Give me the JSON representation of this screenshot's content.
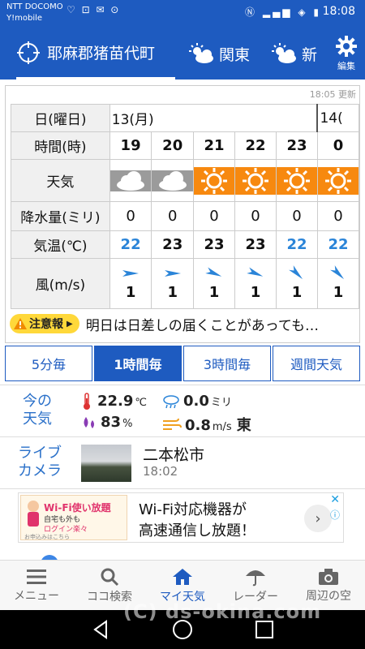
{
  "statusbar": {
    "carrier_line1": "NTT DOCOMO",
    "carrier_line2": "Y!mobile",
    "time": "18:08"
  },
  "header": {
    "tabs": [
      {
        "label": "耶麻郡猪苗代町",
        "icon": "location-target-icon",
        "active": true
      },
      {
        "label": "関東",
        "icon": "sun-cloud-icon",
        "active": false
      },
      {
        "label": "新",
        "icon": "sun-cloud-icon",
        "active": false
      }
    ],
    "settings_label": "編集"
  },
  "forecast": {
    "updated": "18:05 更新",
    "row_headers": {
      "day": "日(曜日)",
      "hour": "時間(時)",
      "weather": "天気",
      "precip": "降水量(ミリ)",
      "temp": "気温(℃)",
      "wind": "風(m/s)"
    },
    "date1": "13(月)",
    "date2": "14(",
    "hours": [
      "19",
      "20",
      "21",
      "22",
      "23",
      "0"
    ],
    "weather": [
      "cloudy",
      "cloudy",
      "sunny",
      "sunny",
      "sunny",
      "sunny"
    ],
    "precip": [
      "0",
      "0",
      "0",
      "0",
      "0",
      "0"
    ],
    "temps": [
      "22",
      "23",
      "23",
      "23",
      "22",
      "22"
    ],
    "temp_colors": [
      "blue",
      "black",
      "black",
      "black",
      "blue",
      "blue"
    ],
    "wind_speed": [
      "1",
      "1",
      "1",
      "1",
      "1",
      "1"
    ],
    "wind_direction": [
      "東",
      "東",
      "東南東",
      "東南東",
      "南東",
      "南東"
    ]
  },
  "notice": {
    "badge": "注意報",
    "text": "明日は日差しの届くことがあっても…"
  },
  "tabs": [
    "5分毎",
    "1時間毎",
    "3時間毎",
    "週間天気"
  ],
  "active_tab": 1,
  "current": {
    "title": "今の\n天気",
    "temp": "22.9",
    "temp_unit": "℃",
    "precip": "0.0",
    "precip_unit": "ミリ",
    "humidity": "83",
    "humidity_unit": "%",
    "wind": "0.8",
    "wind_unit": "m/s",
    "wind_dir": "東"
  },
  "live": {
    "title": "ライブ\nカメラ",
    "city": "二本松市",
    "time": "18:02"
  },
  "ad": {
    "line1": "Wi-Fi対応機器が",
    "line2": "高速通信し放題！",
    "img_text1": "Wi-Fi使い放題",
    "img_text2": "自宅も外も",
    "img_text3": "ログイン楽々",
    "img_text4": "お申込みはこちら"
  },
  "bottom_nav": [
    {
      "label": "メニュー",
      "icon": "menu-icon"
    },
    {
      "label": "ココ検索",
      "icon": "search-icon"
    },
    {
      "label": "マイ天気",
      "icon": "home-icon",
      "active": true
    },
    {
      "label": "レーダー",
      "icon": "umbrella-icon"
    },
    {
      "label": "周辺の空",
      "icon": "camera-icon"
    }
  ],
  "watermark": "(C) ds-okina.com",
  "colors": {
    "primary": "#1e5bc0",
    "sunny": "#f7890f",
    "cloudy": "#9b9b9b",
    "temp_blue": "#2a84d8",
    "badge": "#ffd83a"
  }
}
